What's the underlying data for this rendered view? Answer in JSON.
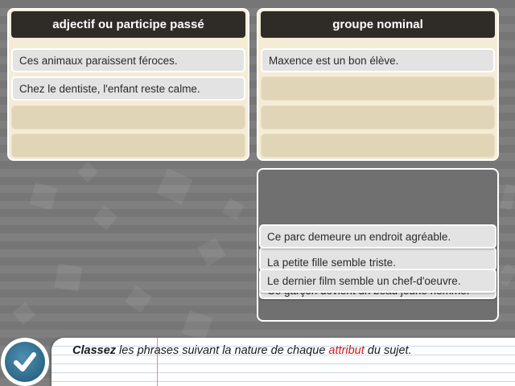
{
  "columns": {
    "left": {
      "header": "adjectif ou participe passé",
      "slots": [
        "Ces animaux paraissent féroces.",
        "Chez le dentiste, l'enfant reste calme.",
        "",
        ""
      ]
    },
    "right": {
      "header": "groupe nominal",
      "slots": [
        "Maxence est un bon élève.",
        "",
        "",
        ""
      ]
    }
  },
  "pool": {
    "cards": {
      "front_top": "Ce parc demeure un endroit agréable.",
      "behind_1": "La petite fille semble triste.",
      "front_bottom": "Le dernier film semble un chef-d'oeuvre.",
      "behind_2": "Ce garçon devient un beau jeune homme."
    }
  },
  "footer": {
    "check_icon": "checkmark-icon",
    "instruction": {
      "bold": "Classez",
      "part1": " les phrases suivant la nature de chaque ",
      "highlight": "attribut",
      "part2": " du sujet."
    }
  },
  "colors": {
    "header_bg": "#2f2b27",
    "column_bg": "#f5ecd7",
    "check_blue": "#2d6787",
    "highlight_red": "#d41818"
  }
}
